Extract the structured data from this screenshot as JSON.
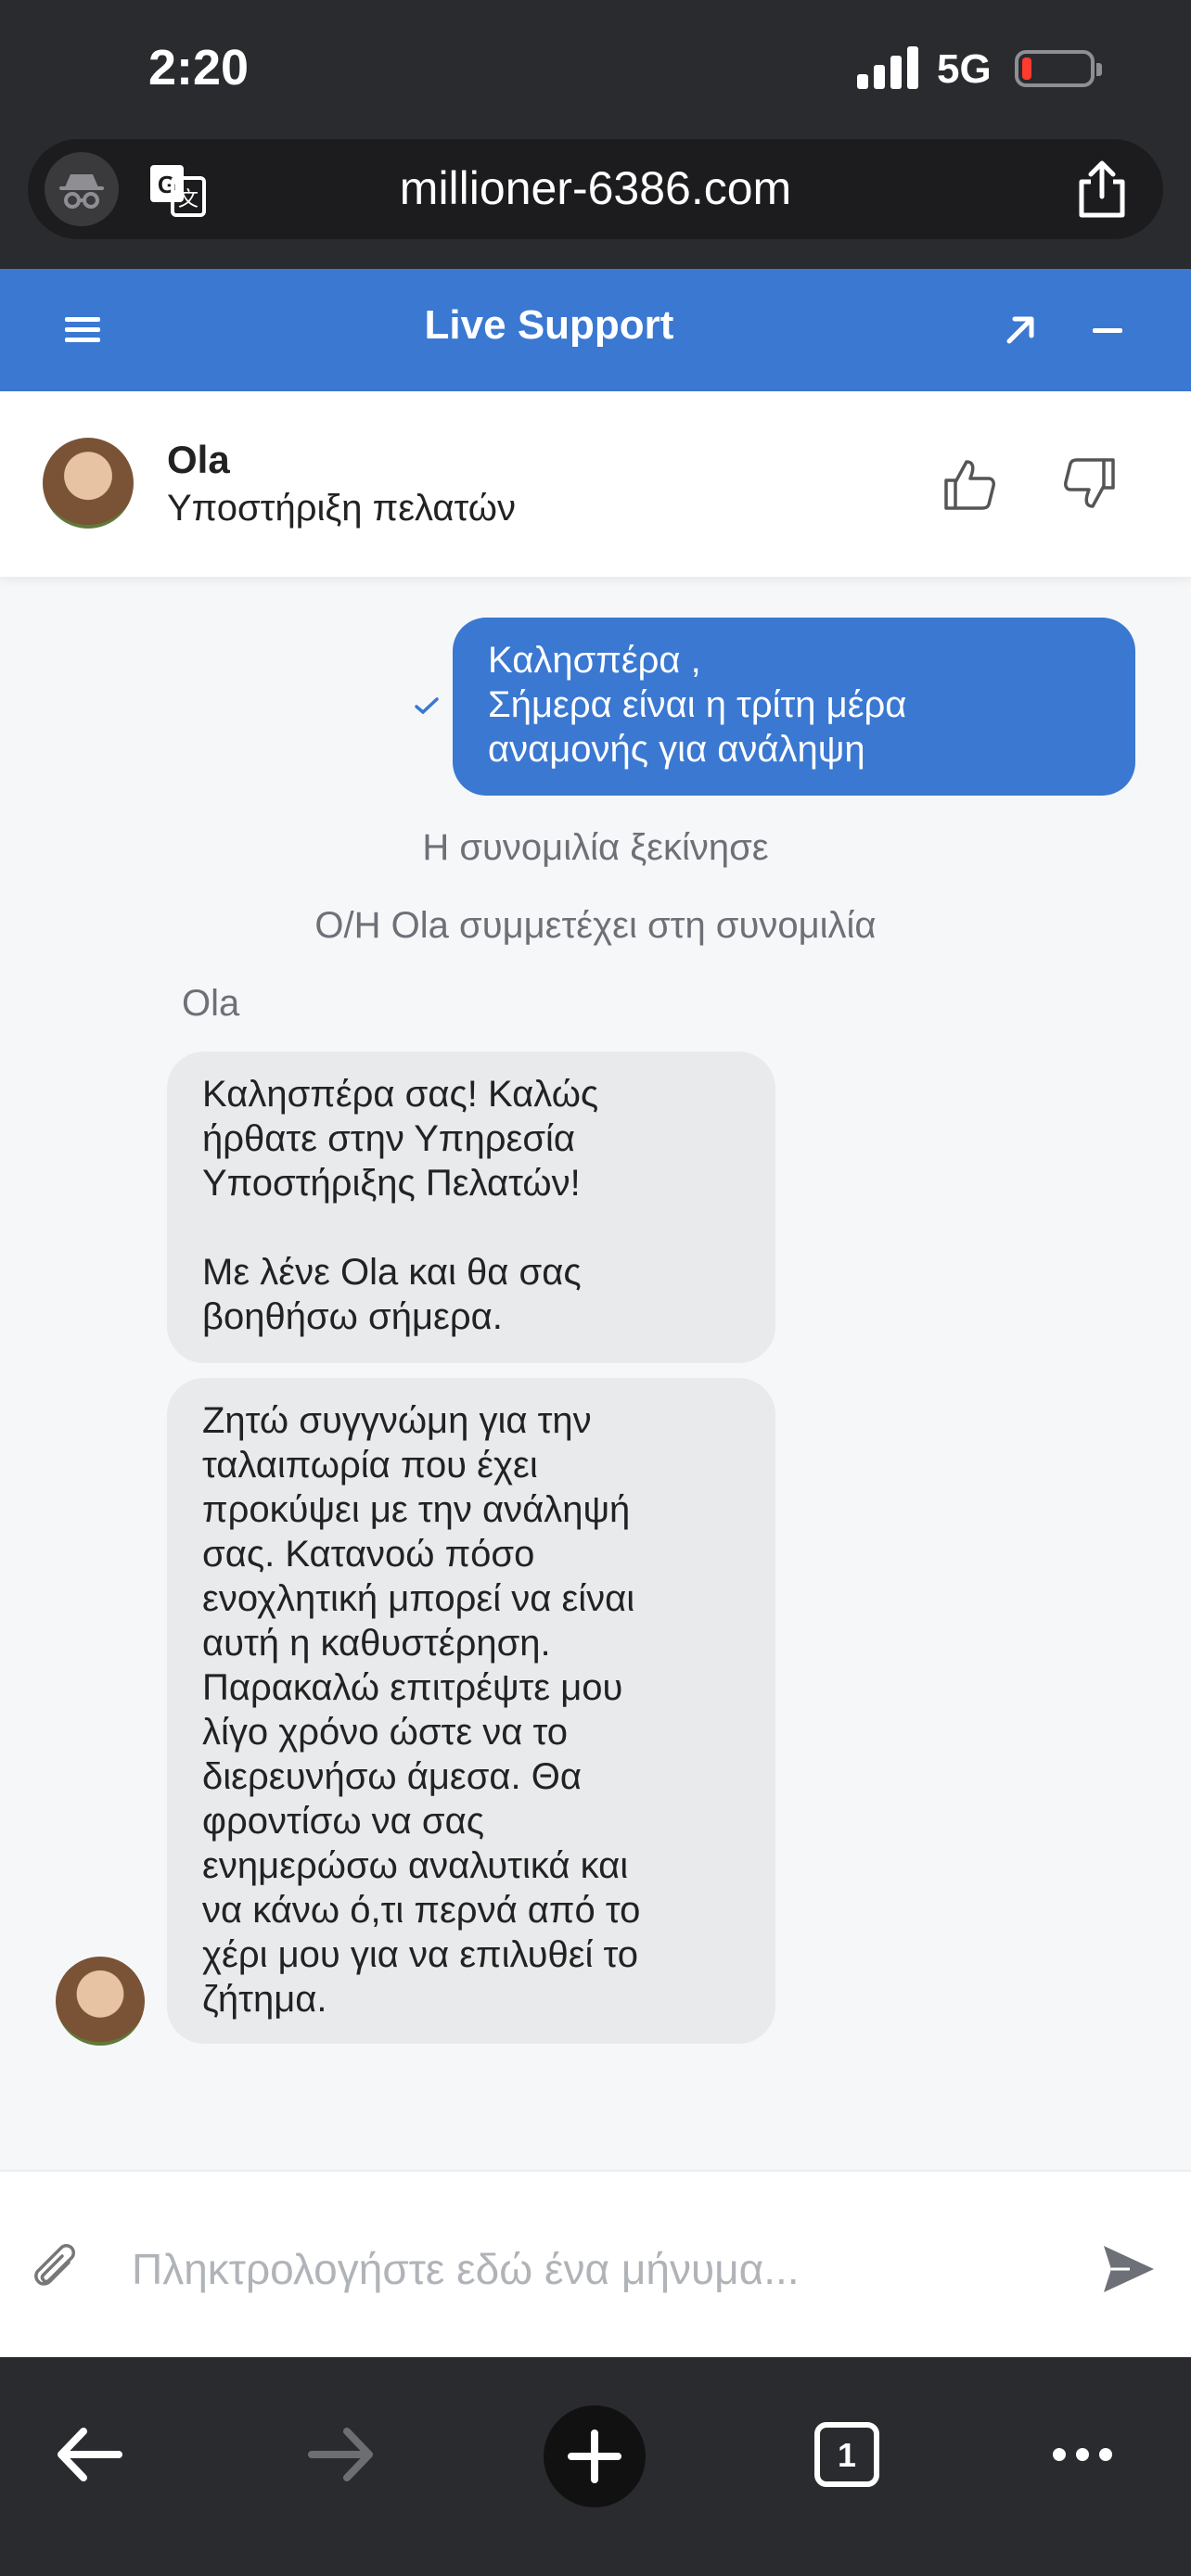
{
  "status_bar": {
    "time": "2:20",
    "network": "5G"
  },
  "browser": {
    "url": "millioner-6386.com"
  },
  "chat_header": {
    "title": "Live Support"
  },
  "agent": {
    "name": "Ola",
    "role": "Υποστήριξη πελατών"
  },
  "messages": {
    "outgoing": "Καλησπέρα ,\nΣήμερα είναι η τρίτη μέρα\nαναμονής για ανάληψη",
    "system_started": "Η συνομιλία ξεκίνησε",
    "system_joined": "Ο/Η Ola συμμετέχει στη συνομιλία",
    "sender_label": "Ola",
    "incoming_1": "Καλησπέρα σας! Καλώς\nήρθατε στην Υπηρεσία\nΥποστήριξης Πελατών!\n\nΜε λένε Ola και θα σας\nβοηθήσω σήμερα.",
    "incoming_2": "Ζητώ συγγνώμη για την\nταλαιπωρία που έχει\nπροκύψει με την ανάληψή\nσας. Κατανοώ πόσο\nενοχλητική μπορεί να είναι\nαυτή η καθυστέρηση.\nΠαρακαλώ επιτρέψτε μου\nλίγο χρόνο ώστε να το\nδιερευνήσω άμεσα. Θα\nφροντίσω να σας\nενημερώσω αναλυτικά και\nνα κάνω ό,τι περνά από το\nχέρι μου για να επιλυθεί το\nζήτημα."
  },
  "composer": {
    "placeholder": "Πληκτρολογήστε εδώ ένα μήνυμα..."
  },
  "toolbar": {
    "tab_count": "1"
  },
  "colors": {
    "accent": "#3a78d2",
    "chrome": "#2a2b2e",
    "incoming_bubble": "#e9eaec"
  }
}
